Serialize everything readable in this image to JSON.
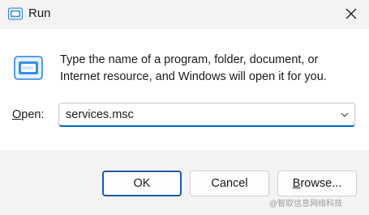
{
  "window": {
    "title": "Run",
    "close_icon": "close-icon",
    "app_icon": "run-app-icon"
  },
  "dialog": {
    "description": "Type the name of a program, folder, document, or Internet resource, and Windows will open it for you.",
    "open_label_prefix": "O",
    "open_label_rest": "pen:",
    "open_value": "services.msc",
    "dropdown_icon": "chevron-down-icon"
  },
  "buttons": {
    "ok": "OK",
    "cancel": "Cancel",
    "browse_prefix": "B",
    "browse_rest": "rowse..."
  },
  "watermark": "@智取信息网络科技",
  "colors": {
    "accent": "#0067c0",
    "ok_border": "#1e5aa8",
    "icon_blue": "#3a8ee6"
  }
}
